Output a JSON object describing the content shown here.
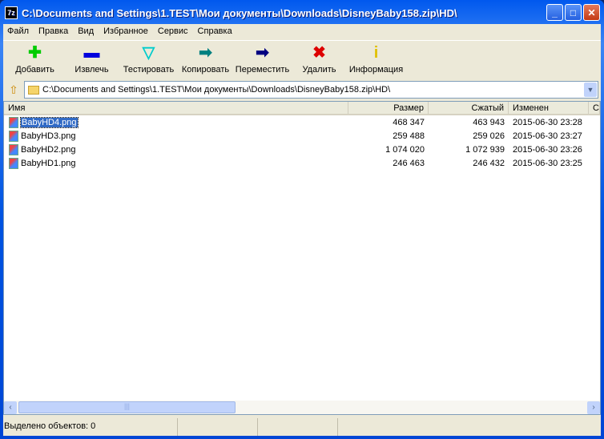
{
  "title": "C:\\Documents and Settings\\1.TEST\\Мои документы\\Downloads\\DisneyBaby158.zip\\HD\\",
  "app_icon": "7z",
  "menu": [
    "Файл",
    "Правка",
    "Вид",
    "Избранное",
    "Сервис",
    "Справка"
  ],
  "toolbar": [
    {
      "label": "Добавить",
      "icon": "plus-icon",
      "glyph": "✚",
      "color": "#00cc00"
    },
    {
      "label": "Извлечь",
      "icon": "minus-icon",
      "glyph": "▬",
      "color": "#0000dd"
    },
    {
      "label": "Тестировать",
      "icon": "check-icon",
      "glyph": "▽",
      "color": "#00cccc"
    },
    {
      "label": "Копировать",
      "icon": "copy-arrow-icon",
      "glyph": "➡",
      "color": "#008080"
    },
    {
      "label": "Переместить",
      "icon": "move-arrow-icon",
      "glyph": "➡",
      "color": "#000080"
    },
    {
      "label": "Удалить",
      "icon": "delete-icon",
      "glyph": "✖",
      "color": "#dd0000"
    },
    {
      "label": "Информация",
      "icon": "info-icon",
      "glyph": "i",
      "color": "#e0c000"
    }
  ],
  "address": "C:\\Documents and Settings\\1.TEST\\Мои документы\\Downloads\\DisneyBaby158.zip\\HD\\",
  "columns": [
    "Имя",
    "Размер",
    "Сжатый",
    "Изменен",
    "С"
  ],
  "files": [
    {
      "name": "BabyHD4.png",
      "size": "468 347",
      "packed": "463 943",
      "modified": "2015-06-30 23:28"
    },
    {
      "name": "BabyHD3.png",
      "size": "259 488",
      "packed": "259 026",
      "modified": "2015-06-30 23:27"
    },
    {
      "name": "BabyHD2.png",
      "size": "1 074 020",
      "packed": "1 072 939",
      "modified": "2015-06-30 23:26"
    },
    {
      "name": "BabyHD1.png",
      "size": "246 463",
      "packed": "246 432",
      "modified": "2015-06-30 23:25"
    }
  ],
  "status": "Выделено объектов: 0"
}
